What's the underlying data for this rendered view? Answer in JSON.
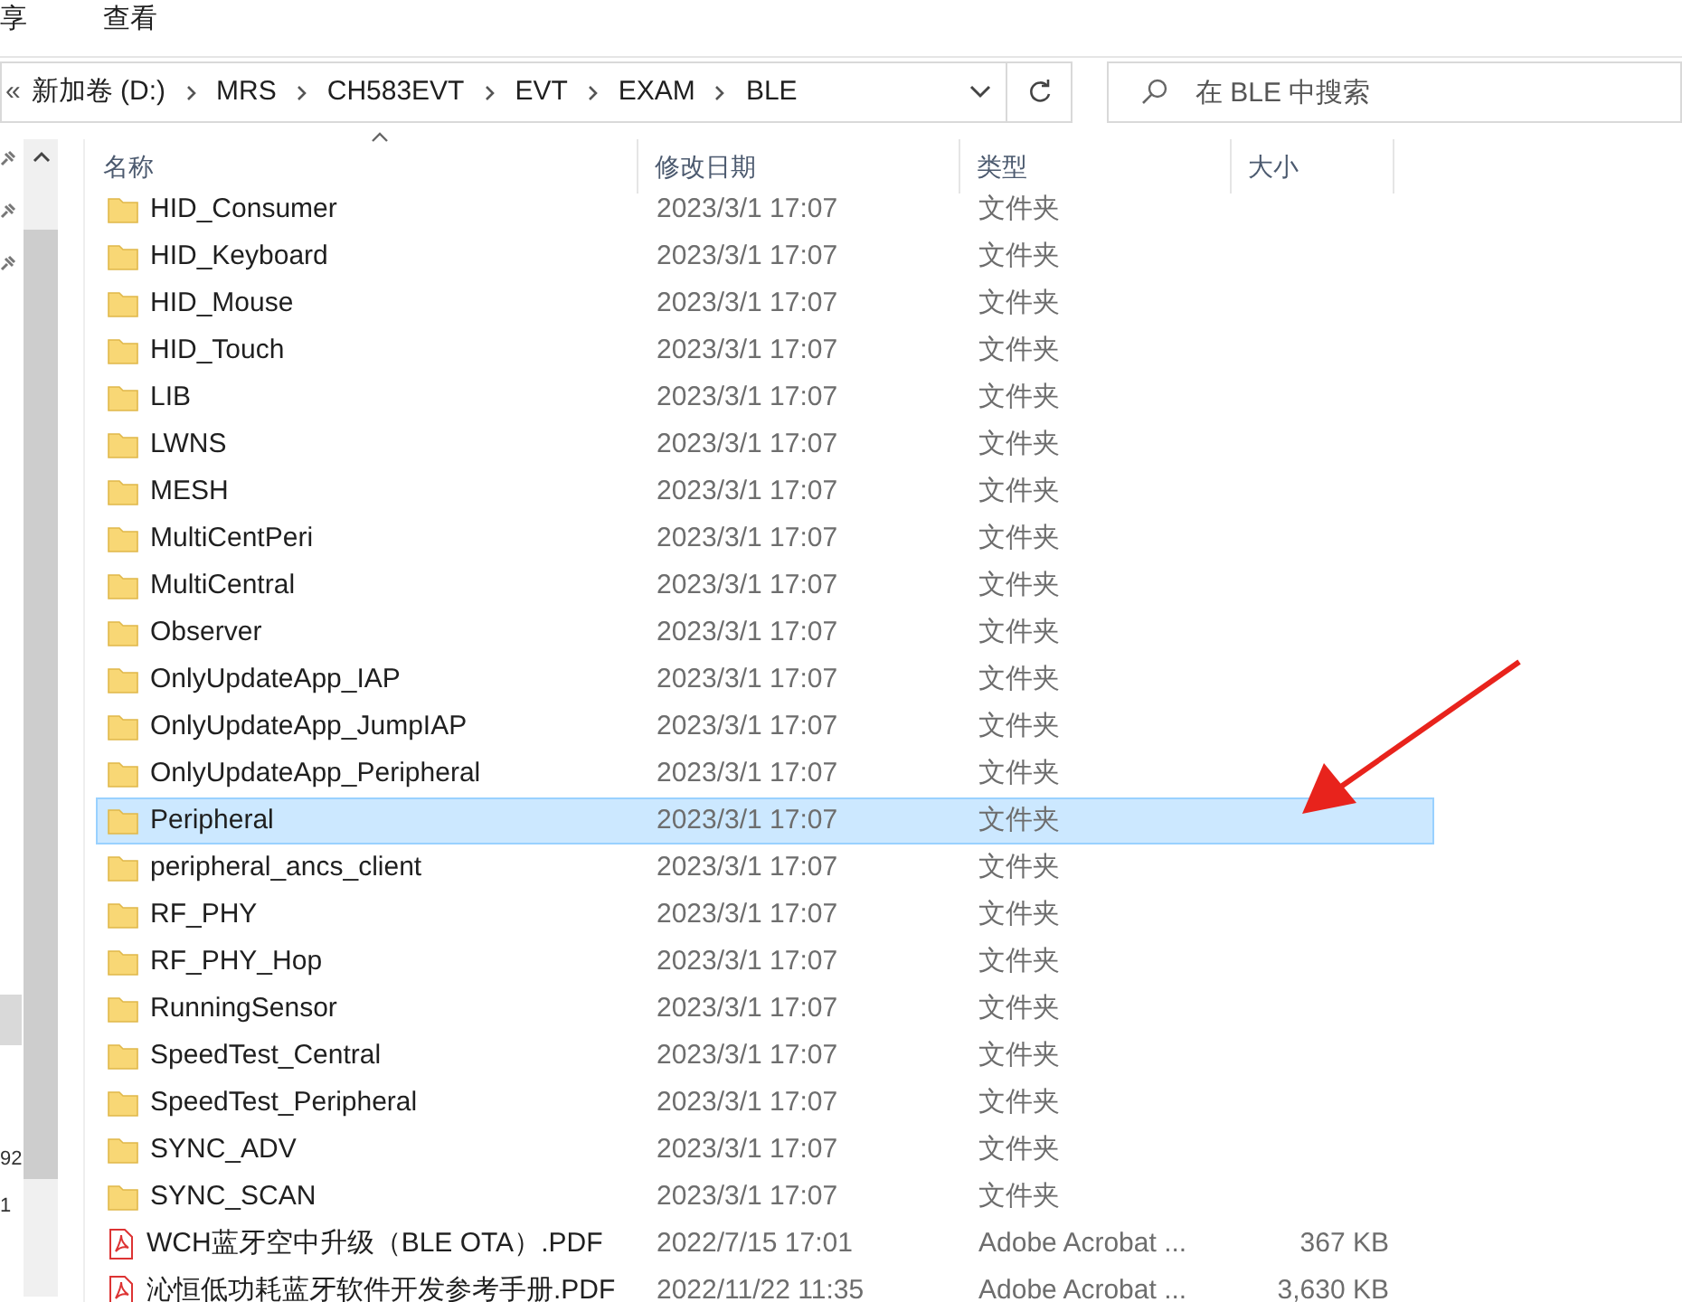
{
  "menu": [
    "享",
    "查看"
  ],
  "breadcrumb": {
    "overflow": "«",
    "items": [
      "新加卷 (D:)",
      "MRS",
      "CH583EVT",
      "EVT",
      "EXAM",
      "BLE"
    ]
  },
  "search": {
    "placeholder": "在 BLE 中搜索"
  },
  "nav_fragments": [
    "92",
    "1"
  ],
  "columns": [
    "名称",
    "修改日期",
    "类型",
    "大小"
  ],
  "rows": [
    {
      "kind": "folder",
      "name": "HID_Consumer",
      "date": "2023/3/1 17:07",
      "type": "文件夹",
      "selected": false
    },
    {
      "kind": "folder",
      "name": "HID_Keyboard",
      "date": "2023/3/1 17:07",
      "type": "文件夹",
      "selected": false
    },
    {
      "kind": "folder",
      "name": "HID_Mouse",
      "date": "2023/3/1 17:07",
      "type": "文件夹",
      "selected": false
    },
    {
      "kind": "folder",
      "name": "HID_Touch",
      "date": "2023/3/1 17:07",
      "type": "文件夹",
      "selected": false
    },
    {
      "kind": "folder",
      "name": "LIB",
      "date": "2023/3/1 17:07",
      "type": "文件夹",
      "selected": false
    },
    {
      "kind": "folder",
      "name": "LWNS",
      "date": "2023/3/1 17:07",
      "type": "文件夹",
      "selected": false
    },
    {
      "kind": "folder",
      "name": "MESH",
      "date": "2023/3/1 17:07",
      "type": "文件夹",
      "selected": false
    },
    {
      "kind": "folder",
      "name": "MultiCentPeri",
      "date": "2023/3/1 17:07",
      "type": "文件夹",
      "selected": false
    },
    {
      "kind": "folder",
      "name": "MultiCentral",
      "date": "2023/3/1 17:07",
      "type": "文件夹",
      "selected": false
    },
    {
      "kind": "folder",
      "name": "Observer",
      "date": "2023/3/1 17:07",
      "type": "文件夹",
      "selected": false
    },
    {
      "kind": "folder",
      "name": "OnlyUpdateApp_IAP",
      "date": "2023/3/1 17:07",
      "type": "文件夹",
      "selected": false
    },
    {
      "kind": "folder",
      "name": "OnlyUpdateApp_JumpIAP",
      "date": "2023/3/1 17:07",
      "type": "文件夹",
      "selected": false
    },
    {
      "kind": "folder",
      "name": "OnlyUpdateApp_Peripheral",
      "date": "2023/3/1 17:07",
      "type": "文件夹",
      "selected": false
    },
    {
      "kind": "folder",
      "name": "Peripheral",
      "date": "2023/3/1 17:07",
      "type": "文件夹",
      "selected": true
    },
    {
      "kind": "folder",
      "name": "peripheral_ancs_client",
      "date": "2023/3/1 17:07",
      "type": "文件夹",
      "selected": false
    },
    {
      "kind": "folder",
      "name": "RF_PHY",
      "date": "2023/3/1 17:07",
      "type": "文件夹",
      "selected": false
    },
    {
      "kind": "folder",
      "name": "RF_PHY_Hop",
      "date": "2023/3/1 17:07",
      "type": "文件夹",
      "selected": false
    },
    {
      "kind": "folder",
      "name": "RunningSensor",
      "date": "2023/3/1 17:07",
      "type": "文件夹",
      "selected": false
    },
    {
      "kind": "folder",
      "name": "SpeedTest_Central",
      "date": "2023/3/1 17:07",
      "type": "文件夹",
      "selected": false
    },
    {
      "kind": "folder",
      "name": "SpeedTest_Peripheral",
      "date": "2023/3/1 17:07",
      "type": "文件夹",
      "selected": false
    },
    {
      "kind": "folder",
      "name": "SYNC_ADV",
      "date": "2023/3/1 17:07",
      "type": "文件夹",
      "selected": false
    },
    {
      "kind": "folder",
      "name": "SYNC_SCAN",
      "date": "2023/3/1 17:07",
      "type": "文件夹",
      "selected": false
    },
    {
      "kind": "pdf",
      "name": "WCH蓝牙空中升级（BLE OTA）.PDF",
      "date": "2022/7/15 17:01",
      "type": "Adobe Acrobat ...",
      "size": "367 KB",
      "selected": false
    },
    {
      "kind": "pdf",
      "name": "沁恒低功耗蓝牙软件开发参考手册.PDF",
      "date": "2022/11/22 11:35",
      "type": "Adobe Acrobat ...",
      "size": "3,630 KB",
      "selected": false
    }
  ]
}
